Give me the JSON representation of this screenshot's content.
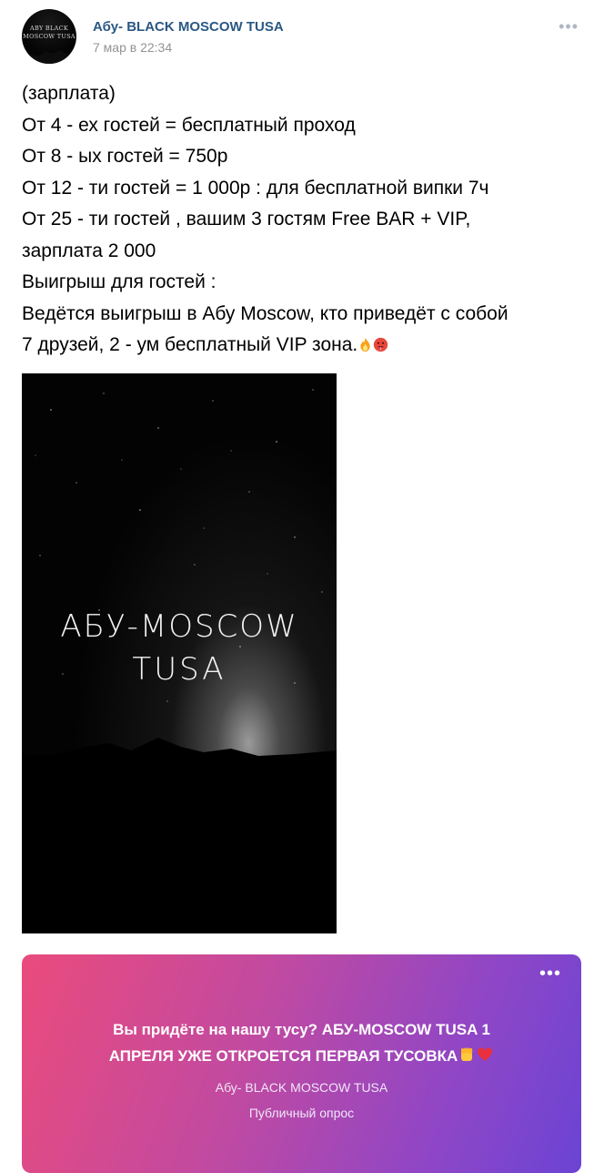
{
  "post": {
    "avatar_text": [
      "ABY BLACK",
      "MOSCOW TUSA"
    ],
    "author": "Абу- BLACK MOSCOW TUSA",
    "date": "7 мар в 22:34",
    "more_label": "•••",
    "text_lines": [
      "(зарплата)",
      "От 4 - ех гостей = бесплатный проход",
      "От 8 - ых гостей = 750р",
      "От 12 - ти гостей = 1 000р : для бесплатной випки 7ч",
      "От 25 - ти гостей , вашим 3 гостям Free BAR + VIP,",
      "зарплата 2 000",
      "Выигрыш для гостей :",
      "Ведётся выигрыш в Абу Moscow, кто приведёт с собой",
      "7 друзей, 2 - ум бесплатный VIP зона."
    ],
    "text_emojis": [
      "fire-emoji",
      "hot-face-emoji"
    ]
  },
  "photo": {
    "title_line1": "АБУ-MOSCOW",
    "title_line2": "TUSA"
  },
  "poll": {
    "more_label": "•••",
    "question_line1": "Вы придёте на нашу тусу? АБУ-MOSCOW TUSA 1",
    "question_line2": "АПРЕЛЯ УЖЕ ОТКРОЕТСЯ ПЕРВАЯ ТУСОВКА",
    "question_emojis": [
      "raised-fist-emoji",
      "red-heart-emoji"
    ],
    "author": "Абу- BLACK MOSCOW TUSA",
    "type": "Публичный опрос",
    "gradient_colors": [
      "#ea4b7c",
      "#c24aa0",
      "#8f46c6",
      "#6b44d4"
    ]
  },
  "colors": {
    "author_link": "#2a5885",
    "date": "#939393"
  }
}
